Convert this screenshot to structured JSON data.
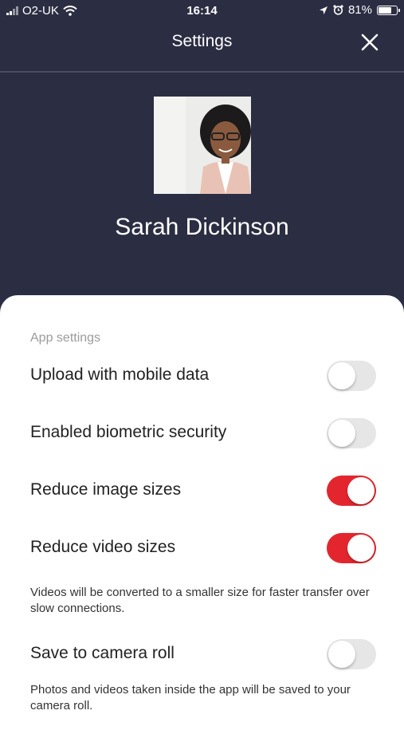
{
  "status_bar": {
    "carrier": "O2-UK",
    "time": "16:14",
    "battery_text": "81%",
    "battery_level": 0.81
  },
  "header": {
    "title": "Settings",
    "close_icon": "close-icon"
  },
  "profile": {
    "name": "Sarah Dickinson"
  },
  "app_settings": {
    "section_label": "App settings",
    "items": [
      {
        "label": "Upload with mobile data",
        "enabled": false
      },
      {
        "label": "Enabled biometric security",
        "enabled": false
      },
      {
        "label": "Reduce image sizes",
        "enabled": true
      },
      {
        "label": "Reduce video sizes",
        "enabled": true,
        "helper": "Videos will be converted to a smaller size for faster transfer over slow connections."
      },
      {
        "label": "Save to camera roll",
        "enabled": false,
        "helper": "Photos and videos taken inside the app will be saved to your camera roll."
      }
    ]
  },
  "colors": {
    "header_bg": "#2b2d42",
    "toggle_on": "#e3262e",
    "toggle_off": "#e6e6e6"
  }
}
